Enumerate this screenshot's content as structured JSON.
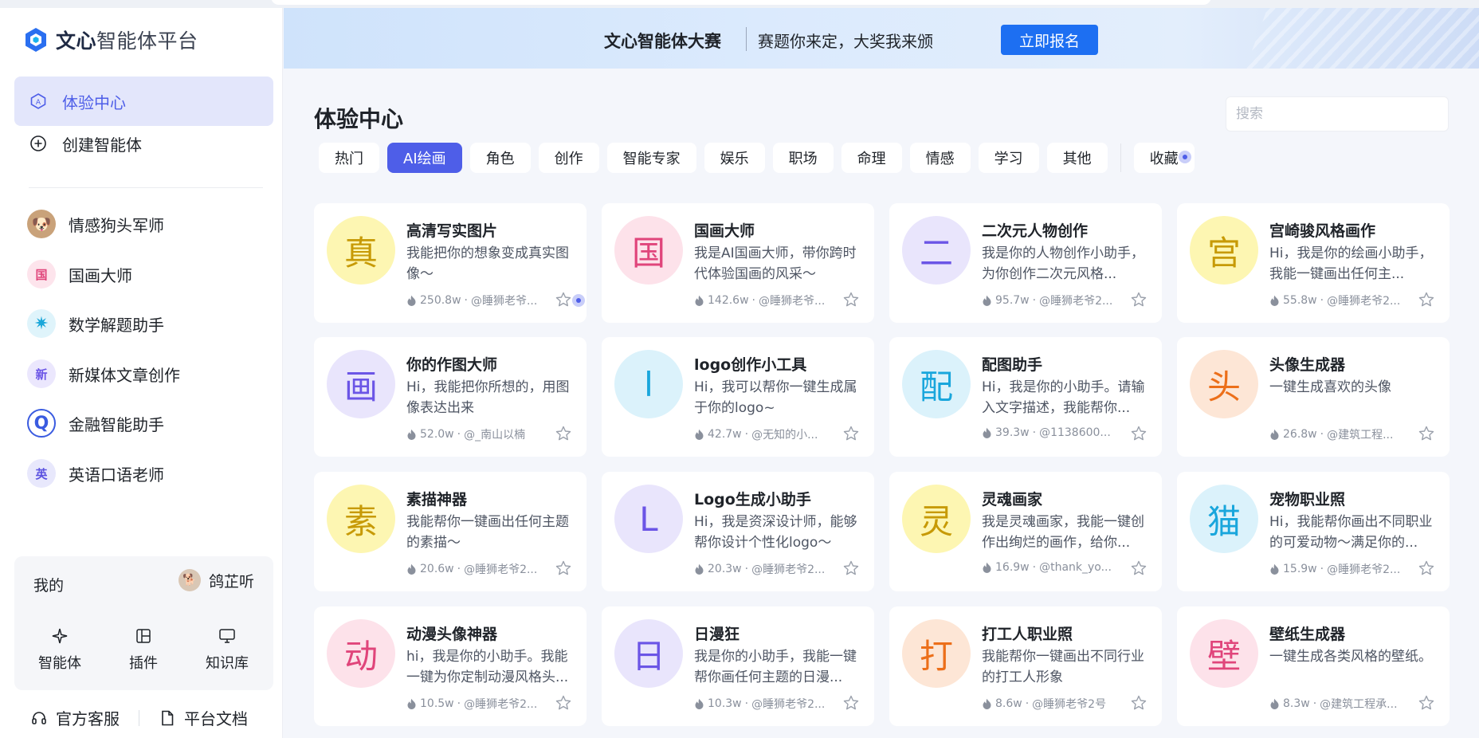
{
  "brand": {
    "bold": "文心",
    "rest": "智能体平台"
  },
  "nav": [
    {
      "label": "体验中心",
      "icon": "agent-center-icon"
    },
    {
      "label": "创建智能体",
      "icon": "plus-circle-icon"
    }
  ],
  "recent": [
    {
      "label": "情感狗头军师",
      "avatar": "🐶",
      "bg": "#c9a27a",
      "fg": "#fff"
    },
    {
      "label": "国画大师",
      "avatar": "国",
      "bg": "#fde4ec",
      "fg": "#e0457b"
    },
    {
      "label": "数学解题助手",
      "avatar": "✷",
      "bg": "#dff4fb",
      "fg": "#1ba7d9"
    },
    {
      "label": "新媒体文章创作",
      "avatar": "新",
      "bg": "#ebe7fd",
      "fg": "#6b55e6"
    },
    {
      "label": "金融智能助手",
      "avatar": "Q",
      "bg": "#ffffff",
      "fg": "#3a5be0"
    },
    {
      "label": "英语口语老师",
      "avatar": "英",
      "bg": "#e8e8fc",
      "fg": "#5b52e0"
    }
  ],
  "mine": {
    "title": "我的",
    "user": "鸽芷听",
    "tools": [
      {
        "label": "智能体",
        "icon": "sparkle-icon"
      },
      {
        "label": "插件",
        "icon": "plugin-icon"
      },
      {
        "label": "知识库",
        "icon": "monitor-icon"
      }
    ]
  },
  "footer": {
    "support": "官方客服",
    "docs": "平台文档"
  },
  "banner": {
    "title": "文心智能体大赛",
    "slogan": "赛题你来定，大奖我来颁",
    "button": "立即报名"
  },
  "page_title": "体验中心",
  "search": {
    "placeholder": "搜索"
  },
  "tabs": [
    "热门",
    "AI绘画",
    "角色",
    "创作",
    "智能专家",
    "娱乐",
    "职场",
    "命理",
    "情感",
    "学习",
    "其他"
  ],
  "tab_favorites": "收藏",
  "active_tab": "AI绘画",
  "cards": [
    {
      "glyph": "真",
      "bg": "#fdf6b2",
      "fg": "#c79a06",
      "title": "高清写实图片",
      "desc": "我能把你的想象变成真实图像～",
      "heat": "250.8w",
      "author": "@睡狮老爷..."
    },
    {
      "glyph": "国",
      "bg": "#fde2ea",
      "fg": "#e0457b",
      "title": "国画大师",
      "desc": "我是AI国画大师，带你跨时代体验国画的风采～",
      "heat": "142.6w",
      "author": "@睡狮老爷..."
    },
    {
      "glyph": "二",
      "bg": "#e9e5fc",
      "fg": "#6b55e6",
      "title": "二次元人物创作",
      "desc": "我是你的人物创作小助手，为你创作二次元风格...",
      "heat": "95.7w",
      "author": "@睡狮老爷2..."
    },
    {
      "glyph": "宫",
      "bg": "#fdf6b2",
      "fg": "#c79a06",
      "title": "宫崎骏风格画作",
      "desc": "Hi，我是你的绘画小助手，我能一键画出任何主...",
      "heat": "55.8w",
      "author": "@睡狮老爷2..."
    },
    {
      "glyph": "画",
      "bg": "#e9e5fc",
      "fg": "#6b55e6",
      "title": "你的作图大师",
      "desc": "Hi，我能把你所想的，用图像表达出来",
      "heat": "52.0w",
      "author": "@_南山以楠"
    },
    {
      "glyph": "l",
      "bg": "#dbf2fb",
      "fg": "#19a6dc",
      "title": "logo创作小工具",
      "desc": "Hi，我可以帮你一键生成属于你的logo~",
      "heat": "42.7w",
      "author": "@无知的小..."
    },
    {
      "glyph": "配",
      "bg": "#dbf2fb",
      "fg": "#19a6dc",
      "title": "配图助手",
      "desc": "Hi，我是你的小助手。请输入文字描述，我能帮你...",
      "heat": "39.3w",
      "author": "@1138600..."
    },
    {
      "glyph": "头",
      "bg": "#fde6d6",
      "fg": "#ec6f1a",
      "title": "头像生成器",
      "desc": "一键生成喜欢的头像",
      "heat": "26.8w",
      "author": "@建筑工程..."
    },
    {
      "glyph": "素",
      "bg": "#fdf6b2",
      "fg": "#c79a06",
      "title": "素描神器",
      "desc": "我能帮你一键画出任何主题的素描～",
      "heat": "20.6w",
      "author": "@睡狮老爷2..."
    },
    {
      "glyph": "L",
      "bg": "#e9e5fc",
      "fg": "#6b55e6",
      "title": "Logo生成小助手",
      "desc": "Hi，我是资深设计师，能够帮你设计个性化logo～",
      "heat": "20.3w",
      "author": "@睡狮老爷2..."
    },
    {
      "glyph": "灵",
      "bg": "#fdf6b2",
      "fg": "#c79a06",
      "title": "灵魂画家",
      "desc": "我是灵魂画家，我能一键创作出绚烂的画作，给你...",
      "heat": "16.9w",
      "author": "@thank_yo..."
    },
    {
      "glyph": "猫",
      "bg": "#dbf2fb",
      "fg": "#19a6dc",
      "title": "宠物职业照",
      "desc": "Hi，我能帮你画出不同职业的可爱动物～满足你的...",
      "heat": "15.9w",
      "author": "@睡狮老爷2..."
    },
    {
      "glyph": "动",
      "bg": "#fde2ea",
      "fg": "#e0457b",
      "title": "动漫头像神器",
      "desc": "hi，我是你的小助手。我能一键为你定制动漫风格头...",
      "heat": "10.5w",
      "author": "@睡狮老爷2..."
    },
    {
      "glyph": "日",
      "bg": "#e9e5fc",
      "fg": "#6b55e6",
      "title": "日漫狂",
      "desc": "我是你的小助手，我能一键帮你画任何主题的日漫...",
      "heat": "10.3w",
      "author": "@睡狮老爷2..."
    },
    {
      "glyph": "打",
      "bg": "#fde6d6",
      "fg": "#ec6f1a",
      "title": "打工人职业照",
      "desc": "我能帮你一键画出不同行业的打工人形象",
      "heat": "8.6w",
      "author": "@睡狮老爷2号"
    },
    {
      "glyph": "壁",
      "bg": "#fde2ea",
      "fg": "#e0457b",
      "title": "壁纸生成器",
      "desc": "一键生成各类风格的壁纸。",
      "heat": "8.3w",
      "author": "@建筑工程承..."
    }
  ],
  "colors": {
    "accent": "#4e5ee8",
    "banner_button": "#1d6ff2"
  }
}
